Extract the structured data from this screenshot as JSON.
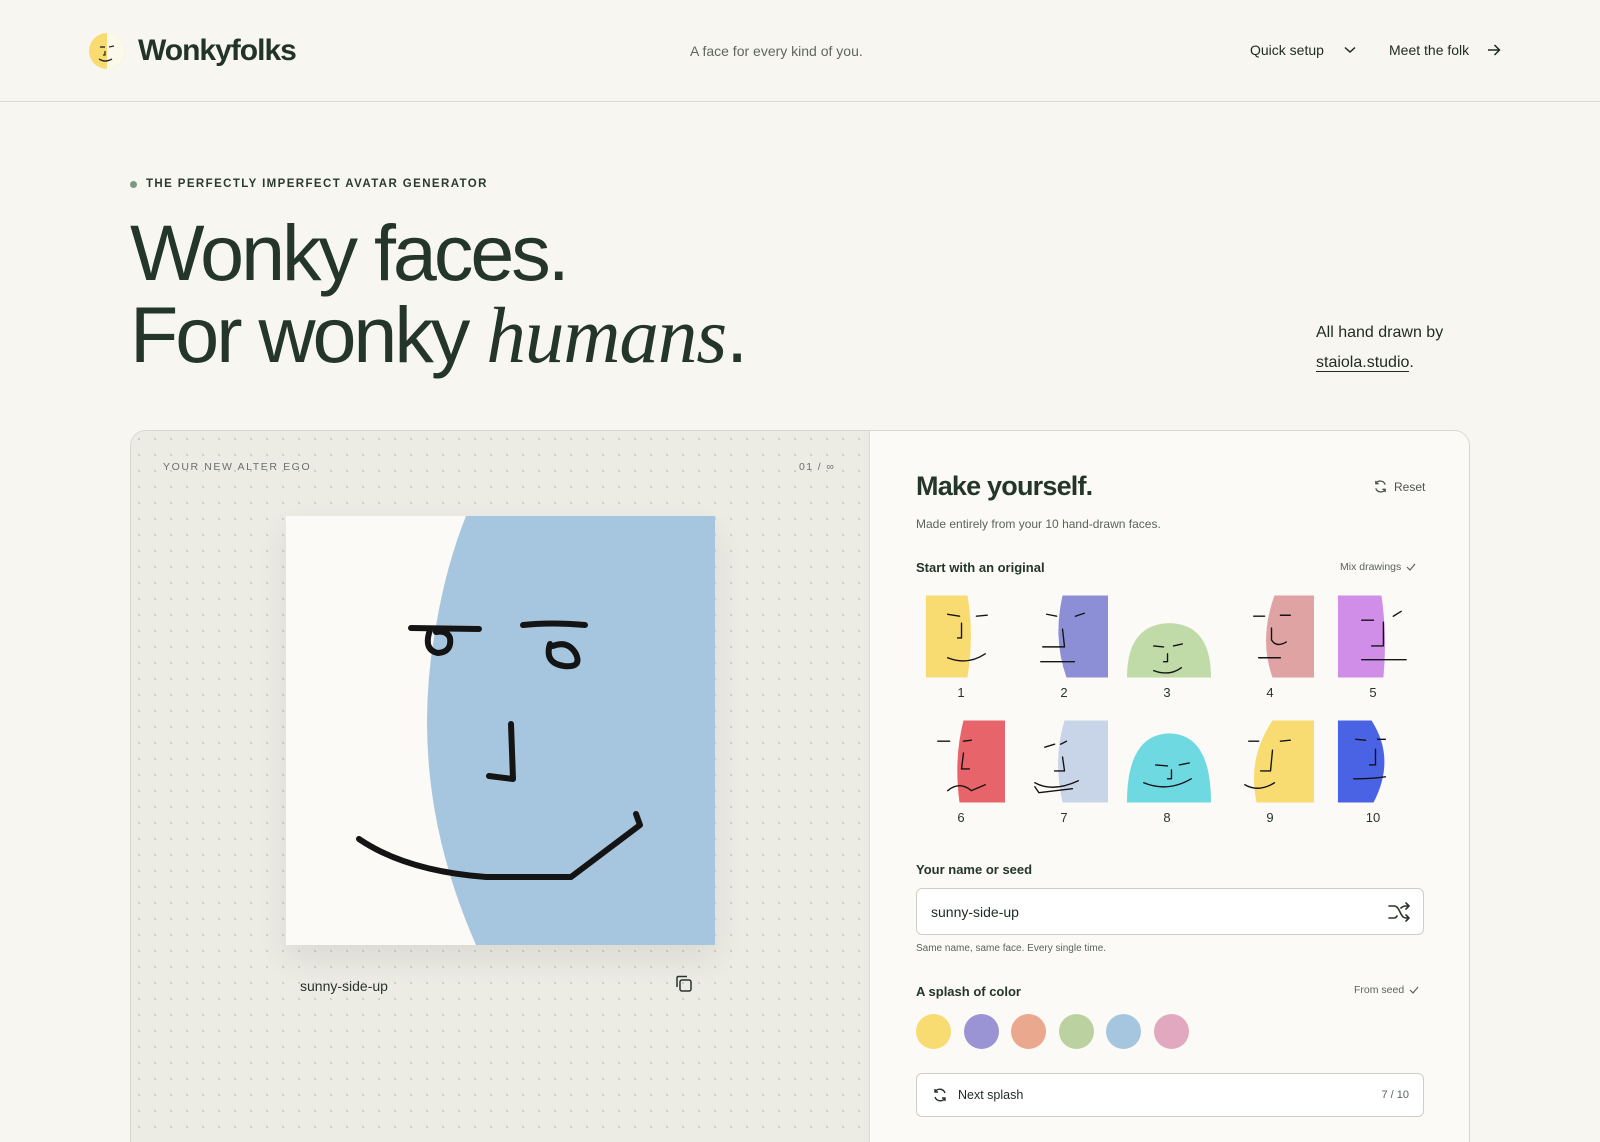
{
  "header": {
    "brand_name": "Wonkyfolks",
    "tagline": "A face for every kind of you.",
    "nav": {
      "quick_setup": "Quick setup",
      "meet_the_folk": "Meet the folk"
    }
  },
  "hero": {
    "eyebrow": "THE PERFECTLY IMPERFECT AVATAR GENERATOR",
    "headline_line1": "Wonky faces.",
    "headline_line2_plain": "For wonky ",
    "headline_line2_italic": "humans",
    "headline_line2_end": ".",
    "credit_prefix": "All hand drawn by",
    "credit_link": "staiola.studio",
    "credit_suffix": "."
  },
  "preview": {
    "label": "YOUR NEW ALTER EGO",
    "count": "01 / ∞",
    "seed_caption": "sunny-side-up",
    "avatar_color": "#a6c6e0"
  },
  "builder": {
    "title": "Make yourself.",
    "reset_label": "Reset",
    "subtitle": "Made entirely from your 10 hand-drawn faces.",
    "originals": {
      "title": "Start with an original",
      "mix_label": "Mix drawings",
      "faces": [
        {
          "num": "1",
          "color": "#f8dc72",
          "icon": "face-1-icon"
        },
        {
          "num": "2",
          "color": "#8d8fd6",
          "icon": "face-2-icon"
        },
        {
          "num": "3",
          "color": "#c1dba8",
          "icon": "face-3-icon"
        },
        {
          "num": "4",
          "color": "#e0a3a3",
          "icon": "face-4-icon"
        },
        {
          "num": "5",
          "color": "#d18ee9",
          "icon": "face-5-icon"
        },
        {
          "num": "6",
          "color": "#e8646b",
          "icon": "face-6-icon"
        },
        {
          "num": "7",
          "color": "#c8d5e8",
          "icon": "face-7-icon"
        },
        {
          "num": "8",
          "color": "#6fd9e2",
          "icon": "face-8-icon"
        },
        {
          "num": "9",
          "color": "#f8dc72",
          "icon": "face-9-icon"
        },
        {
          "num": "10",
          "color": "#4a62e4",
          "icon": "face-10-icon"
        }
      ]
    },
    "seed": {
      "title": "Your name or seed",
      "value": "sunny-side-up",
      "hint": "Same name, same face. Every single time."
    },
    "color": {
      "title": "A splash of color",
      "from_seed_label": "From seed",
      "swatches": [
        "#f8dc72",
        "#9a94d4",
        "#eaa88f",
        "#bcd1a0",
        "#a6c6e0",
        "#e2a8bf"
      ]
    },
    "next_splash": {
      "label": "Next splash",
      "count": "7 / 10"
    }
  }
}
